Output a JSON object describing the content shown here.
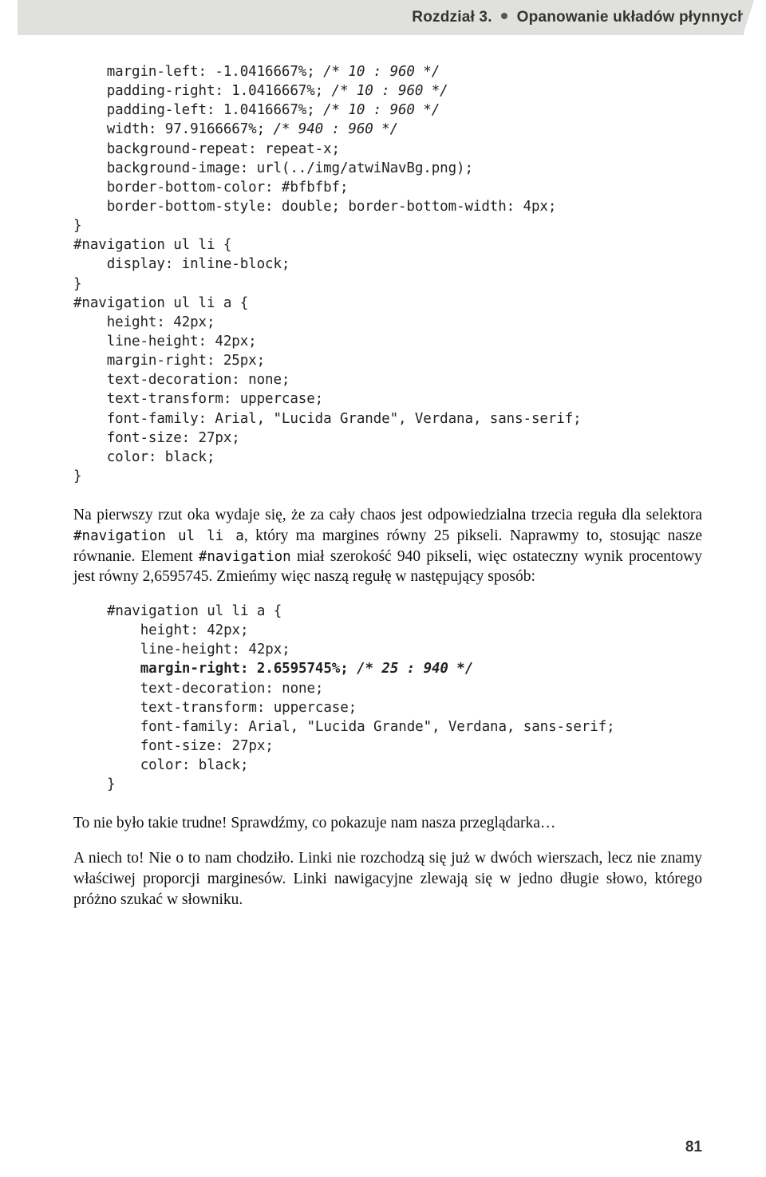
{
  "header": {
    "chapter": "Rozdział 3.",
    "title": "Opanowanie układów płynnych"
  },
  "code1": {
    "l1": "    margin-left: -1.0416667%; ",
    "c1": "/* 10 : 960 */",
    "l2": "    padding-right: 1.0416667%; ",
    "c2": "/* 10 : 960 */",
    "l3": "    padding-left: 1.0416667%; ",
    "c3": "/* 10 : 960 */",
    "l4": "    width: 97.9166667%; ",
    "c4": "/* 940 : 960 */",
    "l5": "    background-repeat: repeat-x;",
    "l6": "    background-image: url(../img/atwiNavBg.png);",
    "l7": "    border-bottom-color: #bfbfbf;",
    "l8": "    border-bottom-style: double; border-bottom-width: 4px;",
    "l9": "}",
    "l10": "#navigation ul li {",
    "l11": "    display: inline-block;",
    "l12": "}",
    "l13": "#navigation ul li a {",
    "l14": "    height: 42px;",
    "l15": "    line-height: 42px;",
    "l16": "    margin-right: 25px;",
    "l17": "    text-decoration: none;",
    "l18": "    text-transform: uppercase;",
    "l19": "    font-family: Arial, \"Lucida Grande\", Verdana, sans-serif;",
    "l20": "    font-size: 27px;",
    "l21": "    color: black;",
    "l22": "}"
  },
  "para1": {
    "t1": "Na pierwszy rzut oka wydaje się, że za cały chaos jest odpowiedzialna trzecia reguła dla selektora ",
    "m1": "#navigation ul li a",
    "t2": ", który ma margines równy 25 pikseli. Naprawmy to, stosując nasze równanie. Element ",
    "m2": "#navigation",
    "t3": " miał szerokość 940 pikseli, więc ostateczny wynik procentowy jest równy 2,6595745. Zmieńmy więc naszą regułę w następujący sposób:"
  },
  "code2": {
    "l1": "#navigation ul li a {",
    "l2": "    height: 42px;",
    "l3": "    line-height: 42px;",
    "b4": "    margin-right: 2.6595745%; ",
    "bc4": "/* 25 : 940 */",
    "l5": "    text-decoration: none;",
    "l6": "    text-transform: uppercase;",
    "l7": "    font-family: Arial, \"Lucida Grande\", Verdana, sans-serif;",
    "l8": "    font-size: 27px;",
    "l9": "    color: black;",
    "l10": "}"
  },
  "para2": "To nie było takie trudne! Sprawdźmy, co pokazuje nam nasza przeglądarka…",
  "para3": "A niech to! Nie o to nam chodziło. Linki nie rozchodzą się już w dwóch wierszach, lecz nie znamy właściwej proporcji marginesów. Linki nawigacyjne zlewają się w jedno długie słowo, którego próżno szukać w słowniku.",
  "pageNumber": "81"
}
